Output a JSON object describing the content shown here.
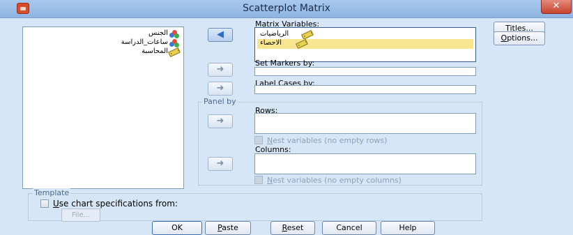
{
  "window": {
    "title": "Scatterplot Matrix",
    "close_label": "✕"
  },
  "source_list": {
    "items": [
      {
        "label": "الجنس",
        "icon": "nominal-variable-icon"
      },
      {
        "label": "ساعات_الدراسة",
        "icon": "nominal-variable-icon"
      },
      {
        "label": "المحاسبة",
        "icon": "scale-variable-icon"
      }
    ]
  },
  "matrix_variables": {
    "label": "Matrix Variables:",
    "items": [
      {
        "label": "الرياضيات",
        "icon": "scale-variable-icon",
        "selected": false
      },
      {
        "label": "الاحصاء",
        "icon": "scale-variable-icon",
        "selected": true
      }
    ]
  },
  "set_markers": {
    "label": "Set Markers by:",
    "value": ""
  },
  "label_cases": {
    "label": "Label Cases by:",
    "value": ""
  },
  "panel_by": {
    "title": "Panel by",
    "rows_label": "Rows:",
    "nest_rows_label": "Nest variables (no empty rows)",
    "columns_label": "Columns:",
    "nest_columns_label": "Nest variables (no empty columns)"
  },
  "template": {
    "title": "Template",
    "use_chart_label": "Use chart specifications from:",
    "file_button": "File..."
  },
  "side_buttons": {
    "titles": "Titles...",
    "options": "Options..."
  },
  "buttons": {
    "ok": "OK",
    "paste": "Paste",
    "reset": "Reset",
    "cancel": "Cancel",
    "help": "Help"
  },
  "colors": {
    "dialog_bg": "#d6e6f6",
    "selected_item": "#f7e68f",
    "titlebar": "#a9c8ec",
    "close": "#c6452e"
  }
}
